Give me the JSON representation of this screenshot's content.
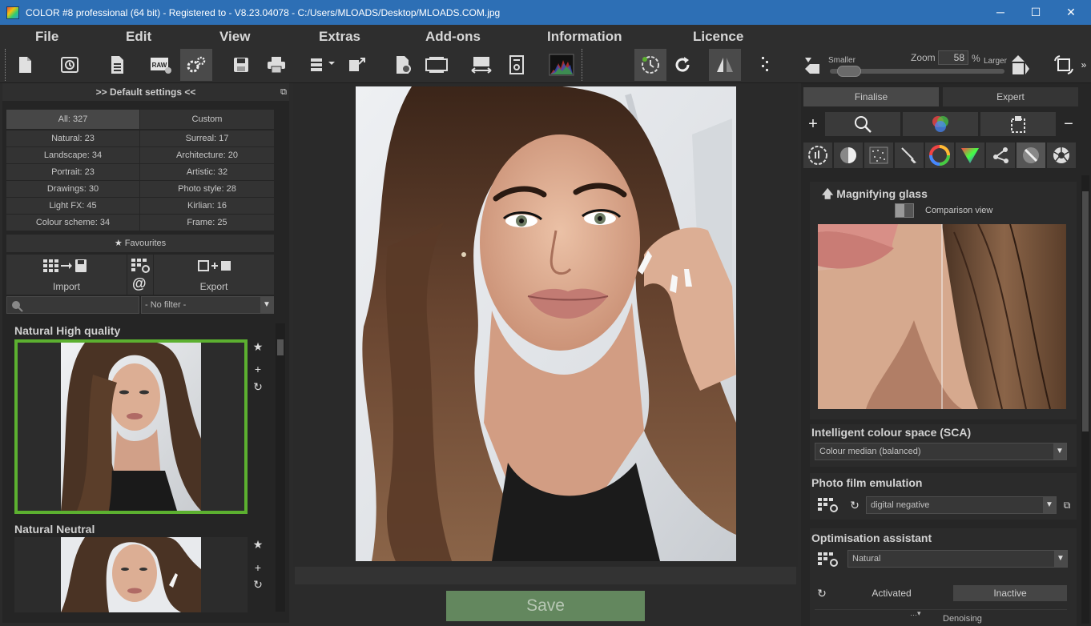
{
  "window": {
    "title": "COLOR #8 professional (64 bit) - Registered to - V8.23.04078 - C:/Users/MLOADS/Desktop/MLOADS.COM.jpg",
    "minimize": "─",
    "maximize": "☐",
    "close": "✕"
  },
  "menu": [
    "File",
    "Edit",
    "View",
    "Extras",
    "Add-ons",
    "Information",
    "Licence"
  ],
  "zoom": {
    "label": "Zoom",
    "value": "58",
    "unit": "%",
    "smaller": "Smaller",
    "larger": "Larger",
    "level": 0.05
  },
  "left": {
    "header": ">> Default settings <<",
    "tabs": [
      "All: 327",
      "Custom"
    ],
    "categories": [
      [
        "Natural: 23",
        "Surreal: 17"
      ],
      [
        "Landscape: 34",
        "Architecture: 20"
      ],
      [
        "Portrait: 23",
        "Artistic: 32"
      ],
      [
        "Drawings: 30",
        "Photo style: 28"
      ],
      [
        "Light FX: 45",
        "Kirlian: 16"
      ],
      [
        "Colour scheme: 34",
        "Frame: 25"
      ]
    ],
    "favourites": "Favourites",
    "import": "Import",
    "export": "Export",
    "filter": "- No filter -",
    "presets": [
      "Natural High quality",
      "Natural Neutral"
    ]
  },
  "center": {
    "save": "Save"
  },
  "right": {
    "tabs": [
      "Finalise",
      "Expert"
    ],
    "magnifier_title": "Magnifying glass",
    "comparison": "Comparison view",
    "sca_title": "Intelligent colour space (SCA)",
    "sca_value": "Colour median (balanced)",
    "film_title": "Photo film emulation",
    "film_value": "digital negative",
    "optim_title": "Optimisation assistant",
    "optim_value": "Natural",
    "activated": "Activated",
    "inactive": "Inactive",
    "denoising": "Denoising"
  },
  "colors": {
    "titlebar": "#2d6fb5",
    "accent_green": "#5cb030",
    "save_green": "#63875e"
  }
}
